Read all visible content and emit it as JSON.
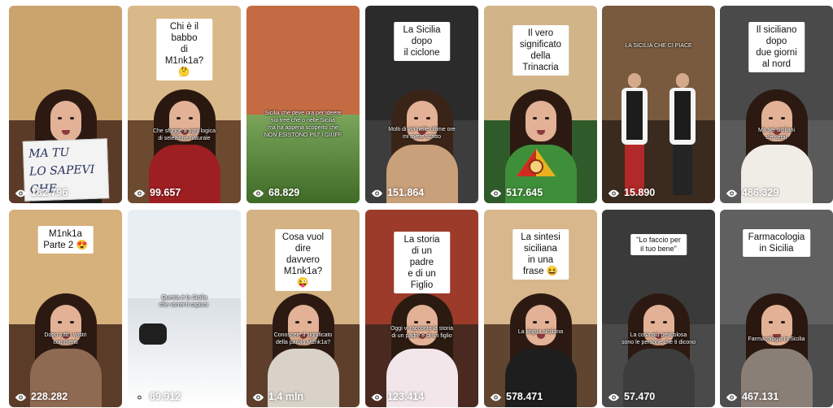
{
  "view_icon": "eye-icon",
  "cards": [
    {
      "id": "c1",
      "views": "182.796",
      "title": "",
      "caption": "",
      "sign": "MA TU\nLO SAPEVI CHE",
      "palette": {
        "wall": "#caa46c",
        "floor": "#5a3b28",
        "top": "#1b1b1b",
        "hair": "#2c1a12"
      }
    },
    {
      "id": "c2",
      "views": "99.657",
      "title": "Chi è il babbo\ndi M1nk1a? 🤔",
      "caption": "Che sfugge a ogni logica\ndi selezione naturale",
      "sign": "",
      "palette": {
        "wall": "#d9b98a",
        "floor": "#6b4a30",
        "top": "#9e1f22",
        "hair": "#2a1810"
      }
    },
    {
      "id": "c3",
      "views": "68.829",
      "title": "",
      "caption": "Sicilia che deve ora per ideere\nsui tree che o nelle Sicilia\nma ha appena scoperto che\nNON ESISTONO PIU' I GIUFF",
      "sign": "",
      "palette": {
        "wall": "#c46b44",
        "floor": "#4f7a2e",
        "top": "#000000",
        "hair": "#000000"
      }
    },
    {
      "id": "c4",
      "views": "151.864",
      "title": "La Sicilia dopo\nil ciclone",
      "caption": "Molti di voi nelle ultime ore\nmi avete scritto",
      "sign": "",
      "palette": {
        "wall": "#2b2b2b",
        "floor": "#3d3d3d",
        "top": "#c8a07a",
        "hair": "#3a2418"
      }
    },
    {
      "id": "c5",
      "views": "517.645",
      "title": "Il vero significato\ndella Trinacria",
      "caption": "",
      "sign": "",
      "palette": {
        "wall": "#d1b488",
        "floor": "#2f5b2a",
        "top": "#3f8f3a",
        "hair": "#2c1a12"
      }
    },
    {
      "id": "c6",
      "views": "15.890",
      "title": "",
      "caption": "LA SICILIA CHE CI PIACE",
      "sign": "",
      "palette": {
        "wall": "#7a5a3e",
        "floor": "#3b2a1e",
        "top": "#202020",
        "hair": "#2a1a10"
      }
    },
    {
      "id": "c7",
      "views": "486.329",
      "title": "Il siciliano dopo\ndue giorni al nord",
      "caption": "Ma sei siciliani\nc'è sera!",
      "sign": "",
      "palette": {
        "wall": "#4a4a4a",
        "floor": "#5a5a5a",
        "top": "#f0ece6",
        "hair": "#2c1a12"
      }
    },
    {
      "id": "c8",
      "views": "228.282",
      "title": "M1nk1a\nParte 2 😍",
      "caption": "Dopo tutti i vostri\ncommenti",
      "sign": "",
      "palette": {
        "wall": "#d6b17b",
        "floor": "#5b3c28",
        "top": "#8f6a52",
        "hair": "#2c1a12"
      }
    },
    {
      "id": "c9",
      "views": "89.912",
      "title": "",
      "caption": "Questa è la Sicilia\nche vorrei ti capisci.",
      "sign": "",
      "palette": {
        "wall": "#e8eef2",
        "floor": "#f4f6f8",
        "top": "#2a2a2a",
        "hair": "#000000"
      }
    },
    {
      "id": "c10",
      "views": "1,4 mln",
      "title": "Cosa vuol dire\ndavvero M1nk1a? 😜",
      "caption": "Conoscete il significato\ndella parola M1nk1a?",
      "sign": "",
      "palette": {
        "wall": "#d4b283",
        "floor": "#5d3f2b",
        "top": "#d8d2c8",
        "hair": "#2c1a12"
      }
    },
    {
      "id": "c11",
      "views": "123.414",
      "title": "La storia di un padre\ne di un Figlio",
      "caption": "Oggi vi racconto la storia\ndi un padre e di un figlio",
      "sign": "",
      "palette": {
        "wall": "#9c3b2a",
        "floor": "#4a2a20",
        "top": "#f2e6ea",
        "hair": "#2a1a10"
      }
    },
    {
      "id": "c12",
      "views": "578.471",
      "title": "La sintesi siciliana\nin una frase 😆",
      "caption": "La lingua siciliana",
      "sign": "",
      "palette": {
        "wall": "#d7b78b",
        "floor": "#604530",
        "top": "#1e1e1e",
        "hair": "#2c1a12"
      }
    },
    {
      "id": "c13",
      "views": "57.470",
      "title": "\"Lo faccio per il tuo bene\"",
      "caption": "La cosa più pericolosa\nsono le persone che ti dicono",
      "sign": "",
      "palette": {
        "wall": "#3a3a3a",
        "floor": "#4a4a4a",
        "top": "#3d3d3d",
        "hair": "#2c1a12"
      }
    },
    {
      "id": "c14",
      "views": "467.131",
      "title": "Farmacologia\nin Sicilia",
      "caption": "Farmacologia in Sicilia",
      "sign": "",
      "palette": {
        "wall": "#606060",
        "floor": "#4d4d4d",
        "top": "#8a7f76",
        "hair": "#2a1810"
      }
    }
  ]
}
